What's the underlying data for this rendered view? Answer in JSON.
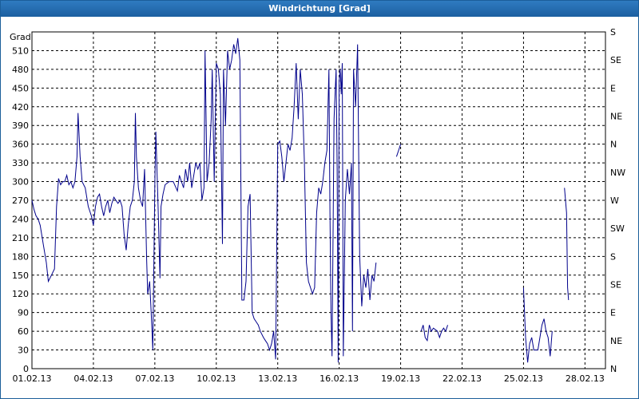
{
  "window": {
    "title": "Windrichtung [Grad]"
  },
  "chart_data": {
    "type": "line",
    "title": "Windrichtung [Grad]",
    "ylabel": "Grad",
    "ylim": [
      0,
      540
    ],
    "xlim": [
      "01.02.13",
      "01.03.13"
    ],
    "y_ticks": [
      0,
      30,
      60,
      90,
      120,
      150,
      180,
      210,
      240,
      270,
      300,
      330,
      360,
      390,
      420,
      450,
      480,
      510
    ],
    "y2_ticks": [
      "N",
      "NE",
      "E",
      "SE",
      "S",
      "SW",
      "W",
      "NW",
      "N",
      "NE",
      "E",
      "SE",
      "S"
    ],
    "x_ticks": [
      "01.02.13",
      "04.02.13",
      "07.02.13",
      "10.02.13",
      "13.02.13",
      "16.02.13",
      "19.02.13",
      "22.02.13",
      "25.02.13",
      "28.02.13"
    ],
    "grid": true,
    "line_color": "#00008b",
    "series": [
      {
        "points": [
          [
            0.0,
            270
          ],
          [
            0.1,
            255
          ],
          [
            0.2,
            245
          ],
          [
            0.3,
            240
          ],
          [
            0.4,
            230
          ],
          [
            0.55,
            200
          ],
          [
            0.7,
            170
          ],
          [
            0.8,
            140
          ],
          [
            0.95,
            150
          ],
          [
            1.1,
            160
          ],
          [
            1.2,
            260
          ],
          [
            1.3,
            305
          ],
          [
            1.4,
            295
          ],
          [
            1.5,
            300
          ],
          [
            1.6,
            300
          ],
          [
            1.7,
            310
          ],
          [
            1.8,
            295
          ],
          [
            1.9,
            300
          ],
          [
            2.0,
            290
          ],
          [
            2.1,
            300
          ],
          [
            2.2,
            340
          ],
          [
            2.25,
            410
          ],
          [
            2.35,
            340
          ],
          [
            2.45,
            300
          ],
          [
            2.6,
            290
          ],
          [
            2.75,
            260
          ],
          [
            2.9,
            245
          ],
          [
            3.0,
            230
          ],
          [
            3.1,
            260
          ],
          [
            3.2,
            275
          ],
          [
            3.3,
            280
          ],
          [
            3.4,
            260
          ],
          [
            3.5,
            245
          ],
          [
            3.6,
            260
          ],
          [
            3.7,
            270
          ],
          [
            3.8,
            250
          ],
          [
            3.9,
            265
          ],
          [
            4.0,
            275
          ],
          [
            4.1,
            270
          ],
          [
            4.2,
            265
          ],
          [
            4.3,
            270
          ],
          [
            4.4,
            260
          ],
          [
            4.5,
            215
          ],
          [
            4.6,
            190
          ],
          [
            4.7,
            230
          ],
          [
            4.8,
            260
          ],
          [
            4.9,
            270
          ],
          [
            5.0,
            300
          ],
          [
            5.05,
            410
          ],
          [
            5.1,
            340
          ],
          [
            5.2,
            290
          ],
          [
            5.3,
            270
          ],
          [
            5.4,
            260
          ],
          [
            5.5,
            320
          ],
          [
            5.6,
            175
          ],
          [
            5.65,
            120
          ],
          [
            5.75,
            140
          ],
          [
            5.85,
            70
          ],
          [
            5.9,
            30
          ],
          [
            6.0,
            300
          ],
          [
            6.05,
            380
          ],
          [
            6.15,
            270
          ],
          [
            6.25,
            145
          ],
          [
            6.3,
            260
          ],
          [
            6.4,
            280
          ],
          [
            6.5,
            295
          ],
          [
            6.7,
            300
          ],
          [
            6.9,
            300
          ],
          [
            7.1,
            285
          ],
          [
            7.2,
            310
          ],
          [
            7.3,
            300
          ],
          [
            7.4,
            290
          ],
          [
            7.5,
            320
          ],
          [
            7.6,
            300
          ],
          [
            7.7,
            330
          ],
          [
            7.8,
            290
          ],
          [
            7.9,
            310
          ],
          [
            8.0,
            330
          ],
          [
            8.1,
            320
          ],
          [
            8.2,
            330
          ],
          [
            8.3,
            270
          ],
          [
            8.4,
            290
          ],
          [
            8.45,
            510
          ],
          [
            8.55,
            300
          ],
          [
            8.65,
            330
          ],
          [
            8.75,
            400
          ],
          [
            8.8,
            480
          ],
          [
            8.9,
            300
          ],
          [
            9.0,
            490
          ],
          [
            9.1,
            480
          ],
          [
            9.2,
            440
          ],
          [
            9.3,
            200
          ],
          [
            9.35,
            480
          ],
          [
            9.45,
            390
          ],
          [
            9.55,
            510
          ],
          [
            9.65,
            480
          ],
          [
            9.75,
            495
          ],
          [
            9.85,
            520
          ],
          [
            9.95,
            505
          ],
          [
            10.05,
            530
          ],
          [
            10.15,
            495
          ],
          [
            10.25,
            110
          ],
          [
            10.35,
            110
          ],
          [
            10.45,
            140
          ],
          [
            10.55,
            260
          ],
          [
            10.65,
            280
          ],
          [
            10.75,
            90
          ],
          [
            10.85,
            80
          ],
          [
            10.95,
            75
          ],
          [
            11.05,
            70
          ],
          [
            11.15,
            60
          ],
          [
            11.3,
            50
          ],
          [
            11.4,
            45
          ],
          [
            11.5,
            40
          ],
          [
            11.6,
            30
          ],
          [
            11.7,
            40
          ],
          [
            11.8,
            60
          ],
          [
            11.9,
            15
          ],
          [
            12.0,
            360
          ],
          [
            12.1,
            365
          ],
          [
            12.2,
            340
          ],
          [
            12.3,
            300
          ],
          [
            12.4,
            330
          ],
          [
            12.5,
            360
          ],
          [
            12.6,
            350
          ],
          [
            12.7,
            370
          ],
          [
            12.8,
            420
          ],
          [
            12.9,
            490
          ],
          [
            13.0,
            400
          ],
          [
            13.1,
            480
          ],
          [
            13.2,
            440
          ],
          [
            13.3,
            330
          ],
          [
            13.4,
            170
          ],
          [
            13.5,
            140
          ],
          [
            13.6,
            130
          ],
          [
            13.7,
            120
          ],
          [
            13.8,
            130
          ],
          [
            13.9,
            250
          ],
          [
            14.0,
            290
          ],
          [
            14.1,
            280
          ],
          [
            14.2,
            300
          ],
          [
            14.3,
            330
          ],
          [
            14.4,
            350
          ],
          [
            14.5,
            480
          ],
          [
            14.55,
            250
          ],
          [
            14.6,
            90
          ],
          [
            14.65,
            20
          ],
          [
            14.75,
            400
          ],
          [
            14.85,
            480
          ],
          [
            14.9,
            320
          ],
          [
            14.95,
            10
          ],
          [
            15.0,
            460
          ],
          [
            15.05,
            480
          ],
          [
            15.1,
            440
          ],
          [
            15.15,
            490
          ],
          [
            15.2,
            20
          ],
          [
            15.3,
            270
          ],
          [
            15.4,
            320
          ],
          [
            15.5,
            280
          ],
          [
            15.6,
            330
          ],
          [
            15.65,
            60
          ],
          [
            15.7,
            480
          ],
          [
            15.8,
            420
          ],
          [
            15.9,
            520
          ],
          [
            16.0,
            180
          ],
          [
            16.1,
            100
          ],
          [
            16.2,
            150
          ],
          [
            16.3,
            130
          ],
          [
            16.4,
            160
          ],
          [
            16.5,
            110
          ],
          [
            16.6,
            150
          ],
          [
            16.7,
            140
          ],
          [
            16.8,
            170
          ]
        ]
      },
      {
        "points": [
          [
            17.8,
            340
          ],
          [
            17.9,
            350
          ],
          [
            18.0,
            360
          ]
        ]
      },
      {
        "points": [
          [
            19.0,
            60
          ],
          [
            19.1,
            70
          ],
          [
            19.2,
            50
          ],
          [
            19.3,
            45
          ],
          [
            19.4,
            70
          ],
          [
            19.5,
            60
          ],
          [
            19.6,
            65
          ],
          [
            19.8,
            60
          ],
          [
            19.9,
            50
          ],
          [
            20.0,
            60
          ],
          [
            20.1,
            65
          ],
          [
            20.2,
            60
          ],
          [
            20.3,
            70
          ]
        ]
      },
      {
        "points": [
          [
            24.0,
            130
          ],
          [
            24.1,
            50
          ],
          [
            24.2,
            10
          ],
          [
            24.3,
            40
          ],
          [
            24.4,
            50
          ],
          [
            24.5,
            30
          ],
          [
            24.7,
            30
          ],
          [
            24.9,
            70
          ],
          [
            25.0,
            80
          ],
          [
            25.1,
            60
          ],
          [
            25.2,
            50
          ],
          [
            25.3,
            20
          ],
          [
            25.4,
            60
          ]
        ]
      },
      {
        "points": [
          [
            26.0,
            290
          ],
          [
            26.05,
            270
          ],
          [
            26.1,
            250
          ],
          [
            26.15,
            130
          ],
          [
            26.2,
            110
          ]
        ]
      }
    ]
  }
}
